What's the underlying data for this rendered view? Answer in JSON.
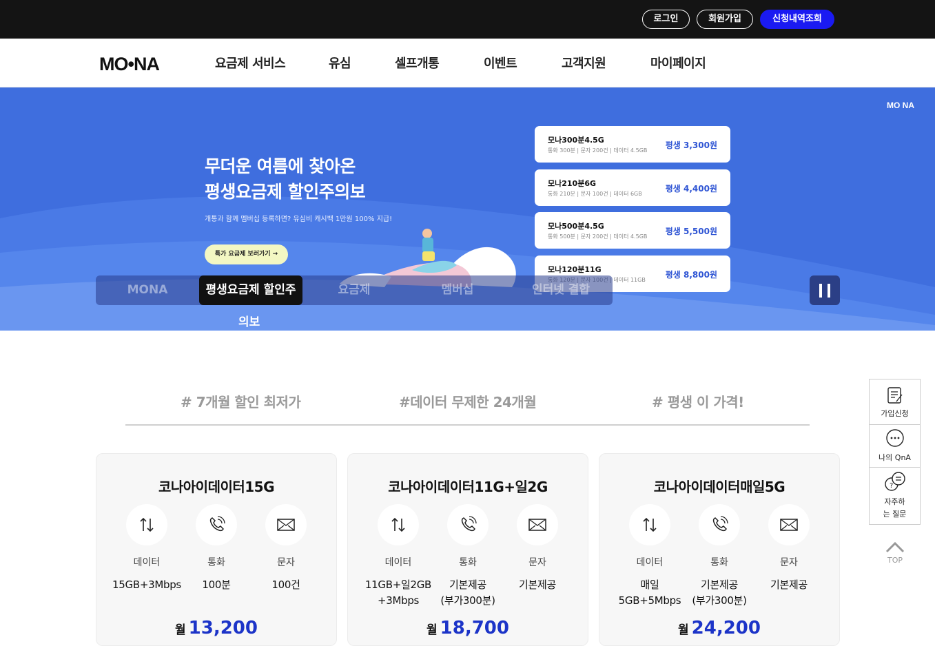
{
  "topbar": {
    "login": "로그인",
    "join": "회원가입",
    "lookup": "신청내역조회"
  },
  "gnb": {
    "logo": "MO•NA",
    "menu": [
      "요금제 서비스",
      "유심",
      "셀프개통",
      "이벤트",
      "고객지원",
      "마이페이지"
    ]
  },
  "hero": {
    "logo": "MO NA",
    "title_line1": "무더운 여름에 찾아온",
    "title_line2": "평생요금제 할인주의보",
    "subtitle": "개통과 함께 멤버십 등록하면? 유심비 캐시백 1만원 100% 지급!",
    "cta": "특가 요금제 보러가기 →",
    "plans": [
      {
        "name": "모나300분4.5G",
        "meta": "통화 300분 | 문자 200건 | 데이터 4.5GB",
        "price": "평생 3,300원"
      },
      {
        "name": "모나210분6G",
        "meta": "통화 210분 | 문자 100건 | 데이터 6GB",
        "price": "평생 4,400원"
      },
      {
        "name": "모나500분4.5G",
        "meta": "통화 500분 | 문자 200건 | 데이터 4.5GB",
        "price": "평생 5,500원"
      },
      {
        "name": "모나120분11G",
        "meta": "통화 120분 | 문자 100건 | 데이터 11GB",
        "price": "평생 8,800원"
      }
    ],
    "tabs": [
      "MONA",
      "평생요금제 할인주",
      "요금제",
      "멤버십",
      "인터넷 결합"
    ],
    "active_tab_wrap": "의보"
  },
  "hashtags": [
    "# 7개월 할인 최저가",
    "#데이터 무제한 24개월",
    "# 평생 이 가격!"
  ],
  "cards": [
    {
      "title": "코나아이데이터15G",
      "features": [
        {
          "icon": "data-arrows-icon",
          "label": "데이터",
          "value": "15GB+3Mbps"
        },
        {
          "icon": "phone-icon",
          "label": "통화",
          "value": "100분"
        },
        {
          "icon": "mail-icon",
          "label": "문자",
          "value": "100건"
        }
      ],
      "price_prefix": "월",
      "price": "13,200"
    },
    {
      "title": "코나아이데이터11G+일2G",
      "features": [
        {
          "icon": "data-arrows-icon",
          "label": "데이터",
          "value": "11GB+일2GB\n+3Mbps"
        },
        {
          "icon": "phone-icon",
          "label": "통화",
          "value": "기본제공\n(부가300분)"
        },
        {
          "icon": "mail-icon",
          "label": "문자",
          "value": "기본제공"
        }
      ],
      "price_prefix": "월",
      "price": "18,700"
    },
    {
      "title": "코나아이데이터매일5G",
      "features": [
        {
          "icon": "data-arrows-icon",
          "label": "데이터",
          "value": "매일\n5GB+5Mbps"
        },
        {
          "icon": "phone-icon",
          "label": "통화",
          "value": "기본제공\n(부가300분)"
        },
        {
          "icon": "mail-icon",
          "label": "문자",
          "value": "기본제공"
        }
      ],
      "price_prefix": "월",
      "price": "24,200"
    }
  ],
  "quick_menu": [
    {
      "icon": "signup-form-icon",
      "label": "가입신청"
    },
    {
      "icon": "qna-chat-icon",
      "label": "나의 QnA"
    },
    {
      "icon": "faq-bubble-icon",
      "label": "자주하는 질문"
    }
  ],
  "top_button": "TOP",
  "colors": {
    "accent": "#1a1af2",
    "hero_bg": "#3f6ede",
    "price": "#1c34c8",
    "topbar": "#141414"
  }
}
